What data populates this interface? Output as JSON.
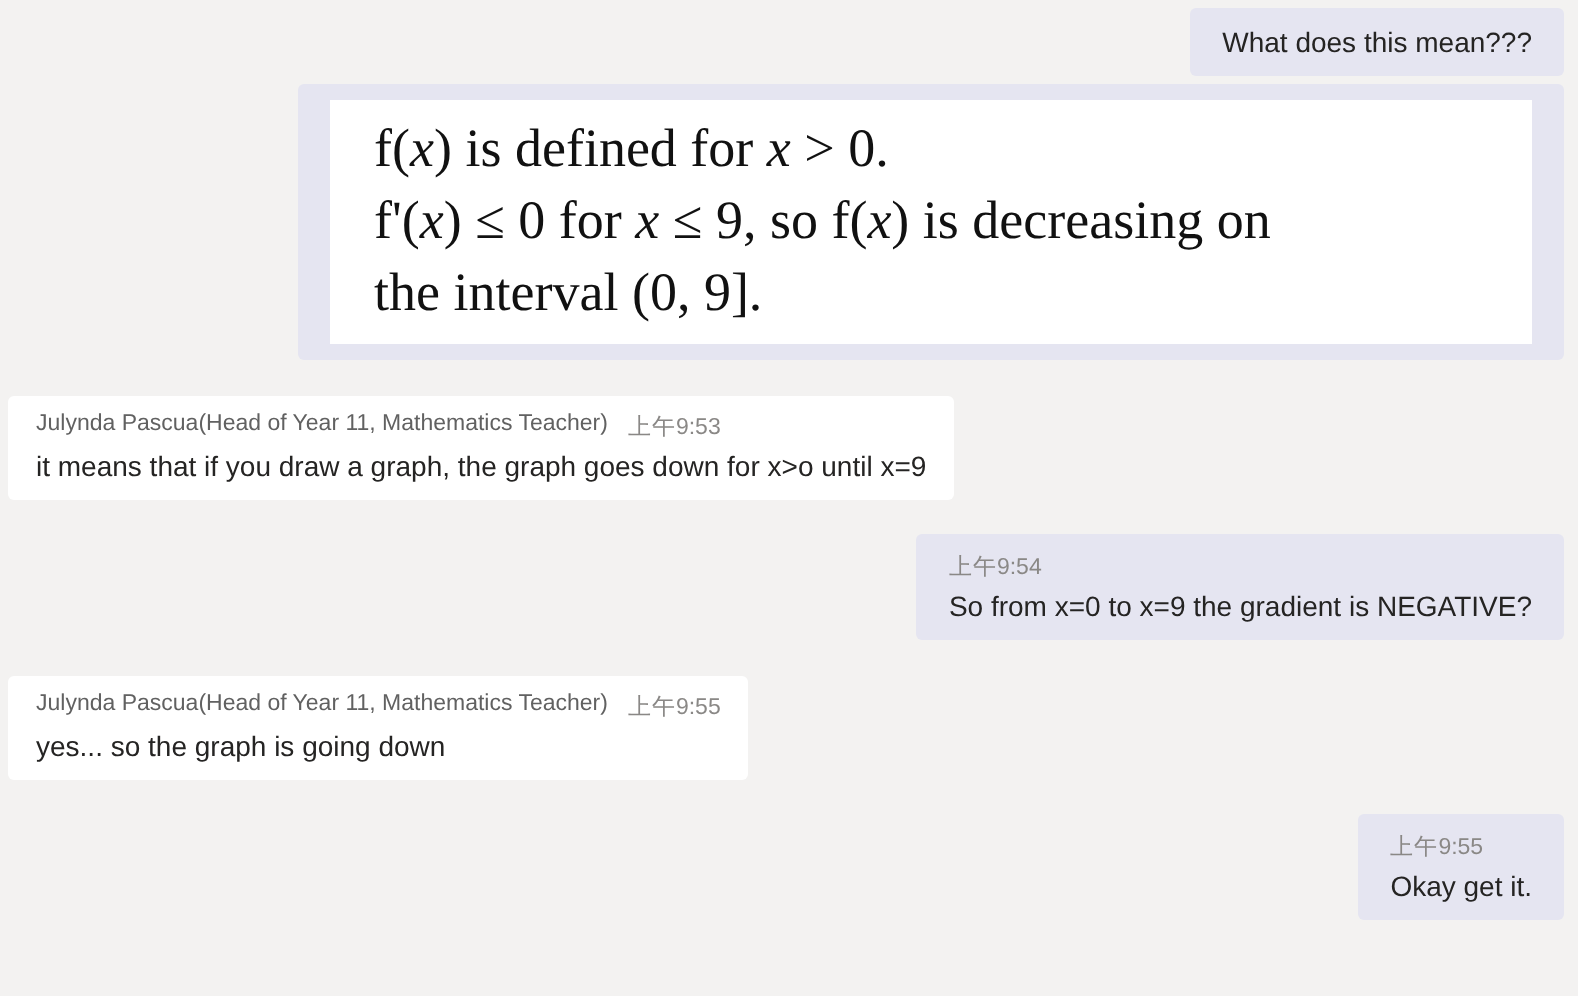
{
  "messages": [
    {
      "outgoing": true,
      "kind": "text",
      "text": "What does this mean???"
    },
    {
      "outgoing": true,
      "kind": "document",
      "lines": [
        "f(*x*) is defined for *x* > 0.",
        "f'(*x*)  ≤  0 for *x*  ≤  9, so f(*x*) is decreasing on",
        "the interval (0, 9]."
      ]
    },
    {
      "outgoing": false,
      "kind": "text",
      "author": "Julynda Pascua(Head of Year 11, Mathematics Teacher)",
      "time": "上午9:53",
      "text": "it means that if you draw a graph, the graph goes down for x>o until x=9"
    },
    {
      "outgoing": true,
      "kind": "text",
      "time": "上午9:54",
      "text": "So from x=0 to x=9 the gradient is NEGATIVE?"
    },
    {
      "outgoing": false,
      "kind": "text",
      "author": "Julynda Pascua(Head of Year 11, Mathematics Teacher)",
      "time": "上午9:55",
      "text": "yes... so the graph is going down"
    },
    {
      "outgoing": true,
      "kind": "text",
      "time": "上午9:55",
      "text": "Okay get it."
    }
  ]
}
